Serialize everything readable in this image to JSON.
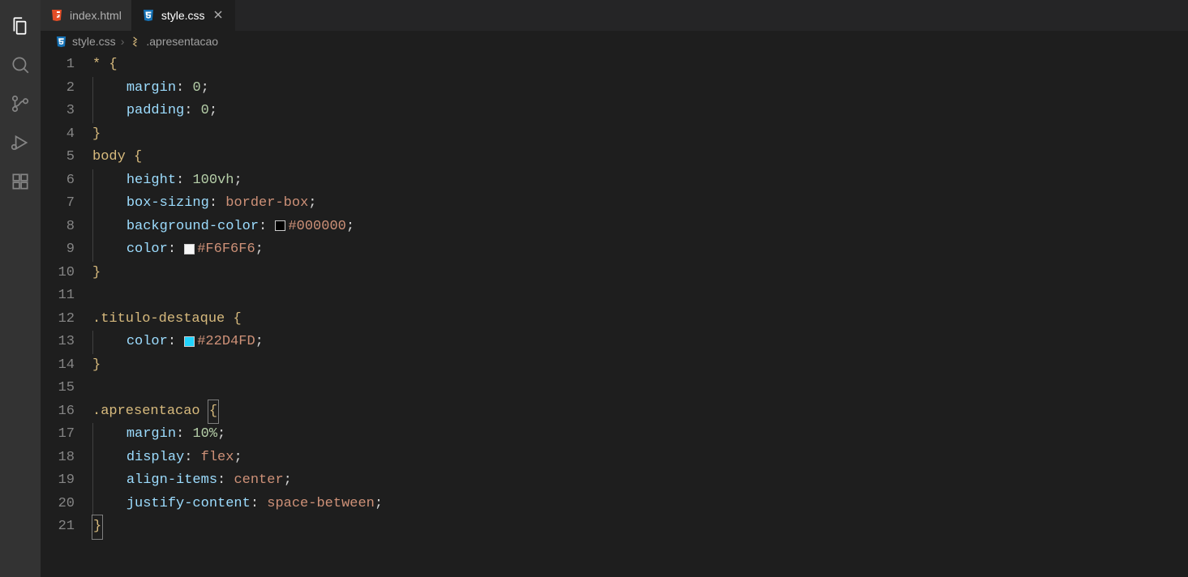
{
  "tabs": [
    {
      "label": "index.html",
      "icon": "html",
      "active": false,
      "close_visible": false
    },
    {
      "label": "style.css",
      "icon": "css",
      "active": true,
      "close_visible": true
    }
  ],
  "breadcrumb": {
    "file": "style.css",
    "symbol": ".apresentacao"
  },
  "activity_bar": {
    "items": [
      {
        "name": "explorer",
        "active": true
      },
      {
        "name": "search",
        "active": false
      },
      {
        "name": "source-control",
        "active": false
      },
      {
        "name": "run-debug",
        "active": false
      },
      {
        "name": "extensions",
        "active": false
      }
    ]
  },
  "editor": {
    "language": "css",
    "lines": [
      "* {",
      "    margin: 0;",
      "    padding: 0;",
      "}",
      "body {",
      "    height: 100vh;",
      "    box-sizing: border-box;",
      "    background-color: #000000;",
      "    color: #F6F6F6;",
      "}",
      "",
      ".titulo-destaque {",
      "    color: #22D4FD;",
      "}",
      "",
      ".apresentacao {",
      "    margin: 10%;",
      "    display: flex;",
      "    align-items: center;",
      "    justify-content: space-between;",
      "}"
    ],
    "color_values": {
      "line8": "#000000",
      "line9": "#F6F6F6",
      "line13": "#22D4FD"
    },
    "prop_values": {
      "line2": {
        "prop": "margin",
        "num": "0"
      },
      "line3": {
        "prop": "padding",
        "num": "0"
      },
      "line6": {
        "prop": "height",
        "num": "100",
        "unit": "vh"
      },
      "line7": {
        "prop": "box-sizing",
        "val": "border-box"
      },
      "line8": {
        "prop": "background-color"
      },
      "line9": {
        "prop": "color"
      },
      "line13": {
        "prop": "color"
      },
      "line17": {
        "prop": "margin",
        "num": "10",
        "unit": "%"
      },
      "line18": {
        "prop": "display",
        "val": "flex"
      },
      "line19": {
        "prop": "align-items",
        "val": "center"
      },
      "line20": {
        "prop": "justify-content",
        "val": "space-between"
      }
    },
    "selectors": {
      "line1": "*",
      "line5": "body",
      "line12": ".titulo-destaque",
      "line16": ".apresentacao"
    },
    "cursor_line": 21
  }
}
